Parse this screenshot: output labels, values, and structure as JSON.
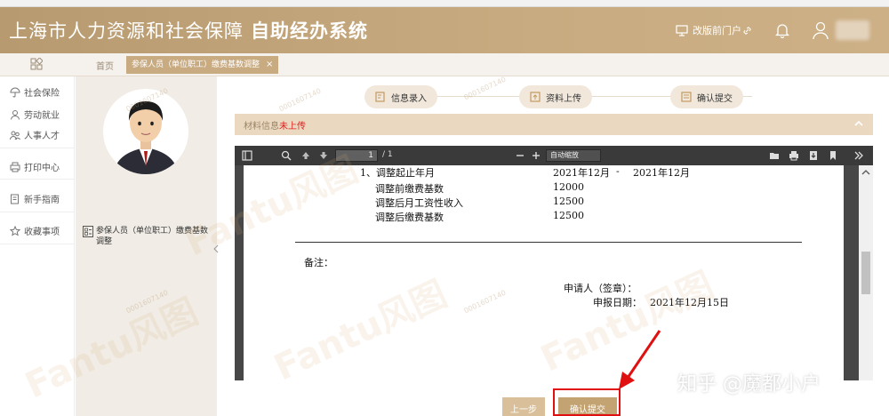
{
  "header": {
    "title": "上海市人力资源和社会保障",
    "subtitle": "自助经办系统",
    "old_portal_label": "改版前门户"
  },
  "tabs": {
    "home": "首页",
    "active": "参保人员（单位职工）缴费基数调整",
    "close": "×"
  },
  "sidebar": {
    "items": [
      {
        "label": "社会保险",
        "icon": "umbrella-icon"
      },
      {
        "label": "劳动就业",
        "icon": "worker-icon"
      },
      {
        "label": "人事人才",
        "icon": "people-icon"
      },
      {
        "label": "打印中心",
        "icon": "printer-icon"
      },
      {
        "label": "新手指南",
        "icon": "guide-icon"
      },
      {
        "label": "收藏事项",
        "icon": "star-icon"
      }
    ]
  },
  "userpanel": {
    "process_label": "参保人员（单位职工）缴费基数调整"
  },
  "steps": [
    {
      "label": "信息录入"
    },
    {
      "label": "资料上传"
    },
    {
      "label": "确认提交"
    }
  ],
  "material": {
    "label": "材料信息",
    "status": "未上传"
  },
  "pdf": {
    "page": "1",
    "page_count": "/ 1",
    "zoom": "自动缩放",
    "lines": [
      "1、调整起止年月",
      "2021年12月",
      "-",
      "2021年12月",
      "调整前缴费基数",
      "12000",
      "调整后月工资性收入",
      "12500",
      "调整后缴费基数",
      "12500",
      "备注：",
      "申请人（签章）：",
      "申报日期：",
      "2021年12月15日"
    ]
  },
  "buttons": {
    "prev": "上一步",
    "confirm": "确认提交"
  },
  "watermark": {
    "text": "Fantu风图",
    "number": "0001607140",
    "credit": "知乎 @魔都小户"
  },
  "colors": {
    "header_gradient_start": "#b89a70",
    "header_gradient_end": "#cdb086",
    "accent": "#c4a373",
    "status_red": "#e02020",
    "annotation_red": "#e01010"
  }
}
